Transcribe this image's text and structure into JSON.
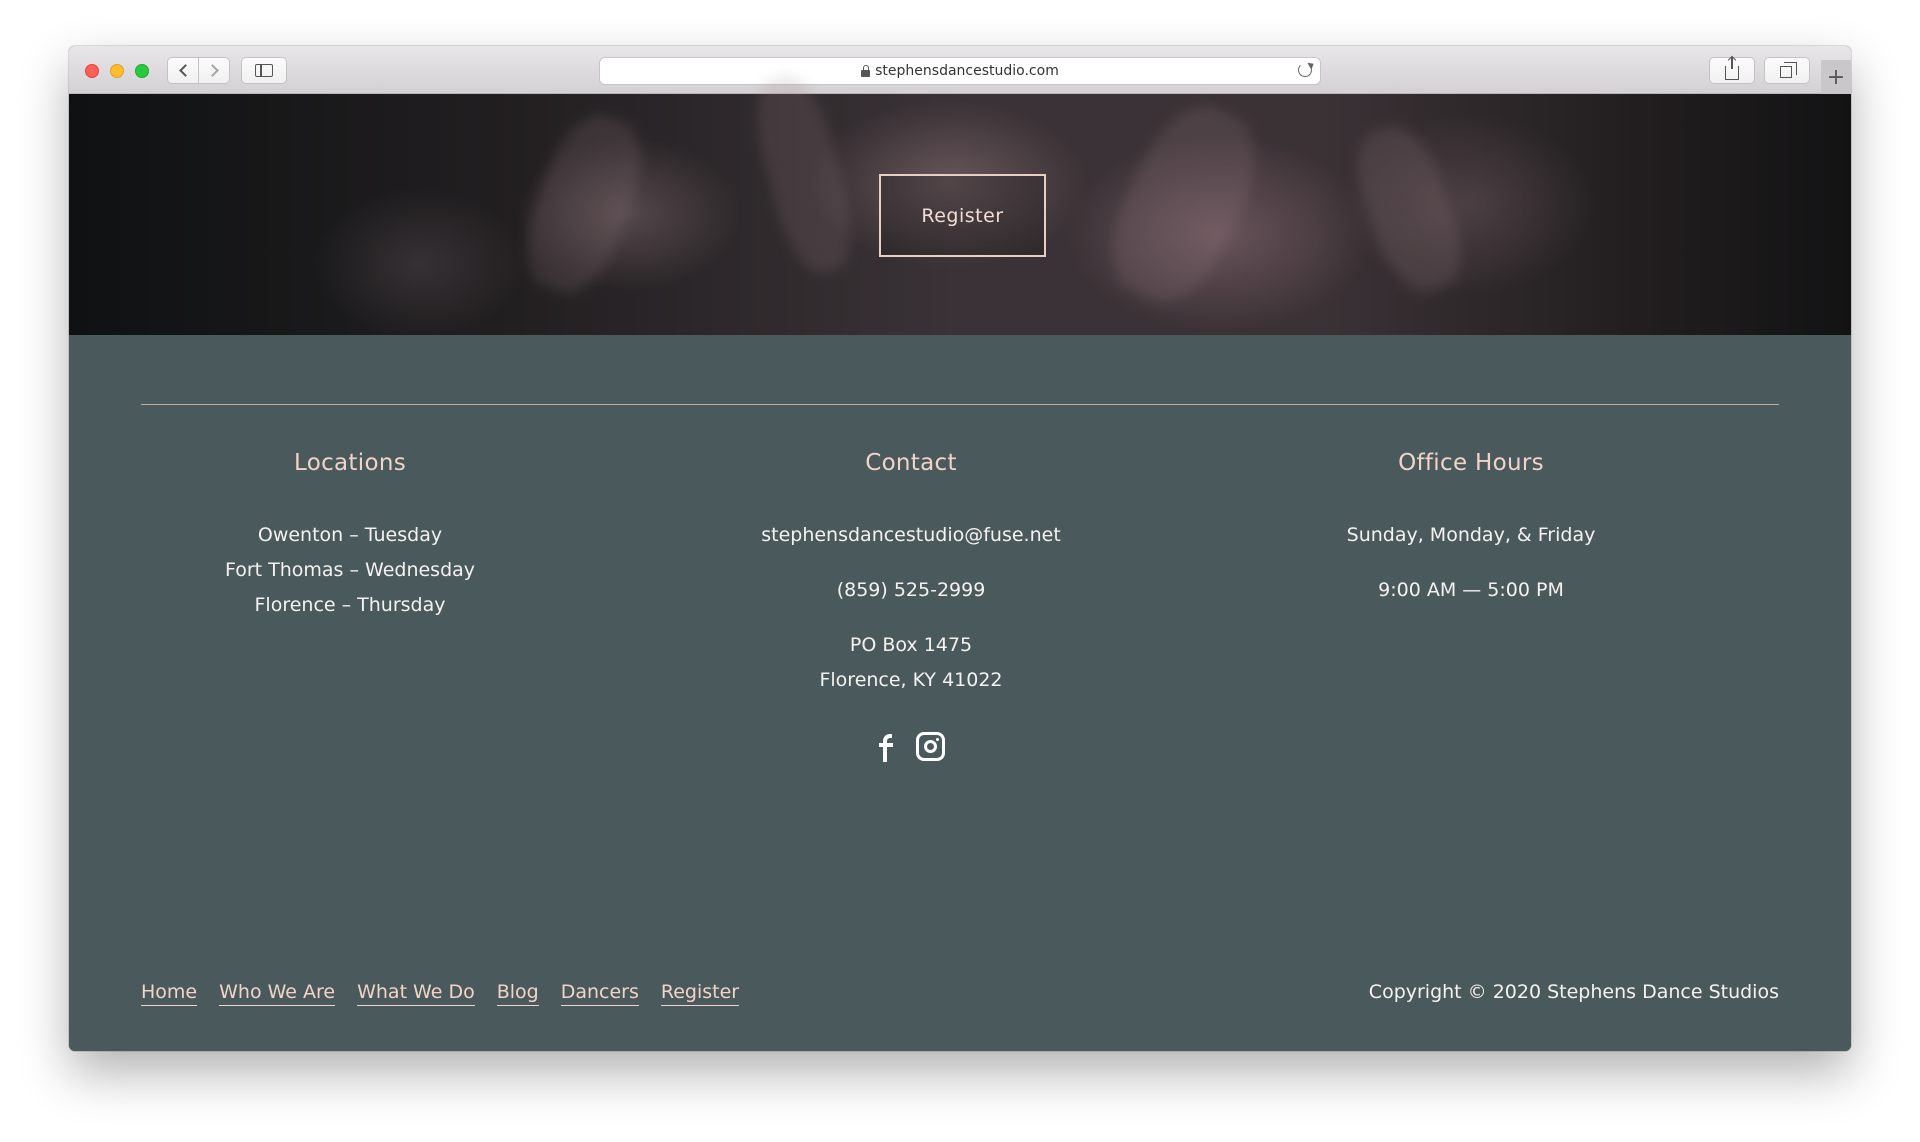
{
  "browser": {
    "url": "stephensdancestudio.com"
  },
  "hero": {
    "register_label": "Register"
  },
  "footer": {
    "locations": {
      "title": "Locations",
      "items": [
        "Owenton – Tuesday",
        "Fort Thomas – Wednesday",
        "Florence – Thursday"
      ]
    },
    "contact": {
      "title": "Contact",
      "email": "stephensdancestudio@fuse.net",
      "phone": "(859) 525-2999",
      "address_line1": "PO Box 1475",
      "address_line2": "Florence, KY 41022",
      "social_icons": [
        "facebook-icon",
        "instagram-icon"
      ]
    },
    "office_hours": {
      "title": "Office Hours",
      "days": "Sunday, Monday, & Friday",
      "hours": "9:00 AM — 5:00 PM"
    },
    "nav": [
      "Home",
      "Who We Are",
      "What We Do",
      "Blog",
      "Dancers",
      "Register"
    ],
    "copyright": "Copyright © 2020 Stephens Dance Studios"
  },
  "colors": {
    "footer_bg": "#4a5a5c",
    "accent": "#f1d3c8",
    "text": "#f5f1ee"
  }
}
